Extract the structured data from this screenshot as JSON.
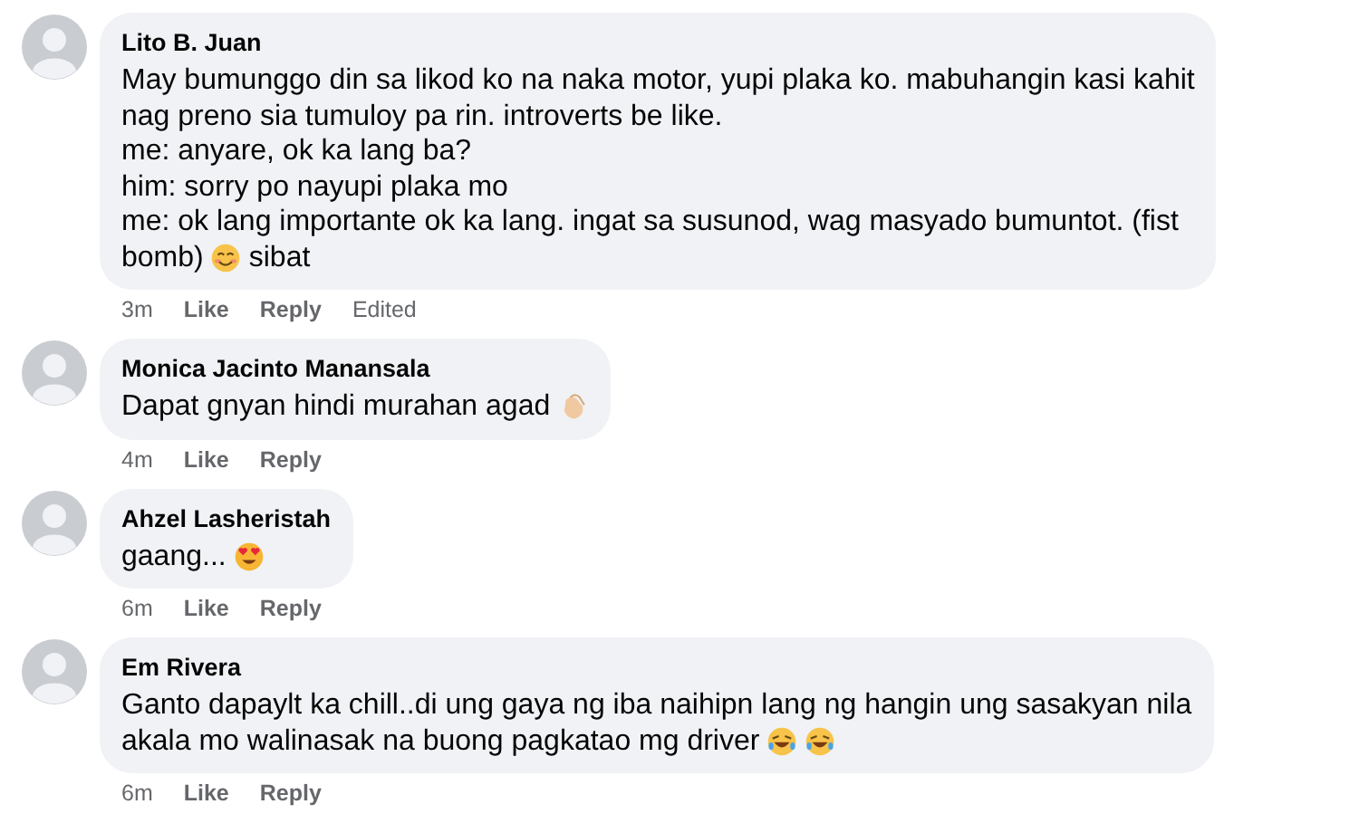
{
  "comments": [
    {
      "author": "Lito B. Juan",
      "lines": [
        [
          {
            "kind": "text",
            "text": "May bumunggo din sa likod ko na naka motor, yupi plaka ko. mabuhangin kasi kahit"
          }
        ],
        [
          {
            "kind": "text",
            "text": "nag preno sia tumuloy pa rin. introverts be like."
          }
        ],
        [
          {
            "kind": "text",
            "text": "me: anyare, ok ka lang ba?"
          }
        ],
        [
          {
            "kind": "text",
            "text": "him: sorry po nayupi plaka mo"
          }
        ],
        [
          {
            "kind": "text",
            "text": "me: ok lang importante ok ka lang. ingat sa susunod, wag masyado bumuntot. (fist"
          }
        ],
        [
          {
            "kind": "text",
            "text": "bomb)"
          },
          {
            "kind": "smile"
          },
          {
            "kind": "text",
            "text": "sibat"
          }
        ]
      ],
      "meta": [
        {
          "kind": "time",
          "text": "3m"
        },
        {
          "kind": "action",
          "text": "Like"
        },
        {
          "kind": "action",
          "text": "Reply"
        },
        {
          "kind": "note",
          "text": "Edited"
        }
      ]
    },
    {
      "author": "Monica Jacinto Manansala",
      "lines": [
        [
          {
            "kind": "text",
            "text": "Dapat gnyan hindi murahan agad"
          },
          {
            "kind": "clap"
          }
        ]
      ],
      "meta": [
        {
          "kind": "time",
          "text": "4m"
        },
        {
          "kind": "action",
          "text": "Like"
        },
        {
          "kind": "action",
          "text": "Reply"
        }
      ]
    },
    {
      "author": "Ahzel Lasheristah",
      "lines": [
        [
          {
            "kind": "text",
            "text": "gaang..."
          },
          {
            "kind": "heart-eyes"
          }
        ]
      ],
      "meta": [
        {
          "kind": "time",
          "text": "6m"
        },
        {
          "kind": "action",
          "text": "Like"
        },
        {
          "kind": "action",
          "text": "Reply"
        }
      ]
    },
    {
      "author": "Em Rivera",
      "lines": [
        [
          {
            "kind": "text",
            "text": "Ganto dapaylt ka chill..di ung gaya ng iba naihipn lang ng hangin ung sasakyan nila"
          }
        ],
        [
          {
            "kind": "text",
            "text": "akala mo walinasak na buong pagkatao mg driver"
          },
          {
            "kind": "laugh"
          },
          {
            "kind": "laugh"
          }
        ]
      ],
      "meta": [
        {
          "kind": "time",
          "text": "6m"
        },
        {
          "kind": "action",
          "text": "Like"
        },
        {
          "kind": "action",
          "text": "Reply"
        }
      ]
    }
  ]
}
